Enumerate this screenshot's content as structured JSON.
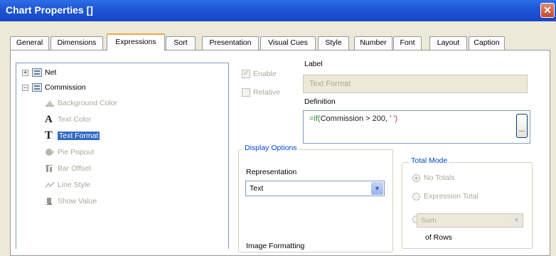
{
  "window": {
    "title": "Chart Properties []",
    "close_glyph": "✕"
  },
  "tabs": [
    {
      "label": "General",
      "active": false
    },
    {
      "label": "Dimensions",
      "active": false
    },
    {
      "label": "Expressions",
      "active": true
    },
    {
      "label": "Sort",
      "active": false
    },
    {
      "label": "Presentation",
      "active": false
    },
    {
      "label": "Visual Cues",
      "active": false
    },
    {
      "label": "Style",
      "active": false
    },
    {
      "label": "Number",
      "active": false
    },
    {
      "label": "Font",
      "active": false
    },
    {
      "label": "Layout",
      "active": false
    },
    {
      "label": "Caption",
      "active": false
    }
  ],
  "tree": {
    "net": {
      "label": "Net",
      "expander": "+"
    },
    "commission": {
      "label": "Commission",
      "expander": "−"
    },
    "attributes": [
      {
        "label": "Background Color",
        "icon": "background-color-icon",
        "enabled": false,
        "selected": false
      },
      {
        "label": "Text Color",
        "icon": "text-color-icon",
        "enabled": false,
        "selected": false
      },
      {
        "label": "Text Format",
        "icon": "text-format-icon",
        "enabled": true,
        "selected": true
      },
      {
        "label": "Pie Popout",
        "icon": "pie-popout-icon",
        "enabled": false,
        "selected": false
      },
      {
        "label": "Bar Offset",
        "icon": "bar-offset-icon",
        "enabled": false,
        "selected": false
      },
      {
        "label": "Line Style",
        "icon": "line-style-icon",
        "enabled": false,
        "selected": false
      },
      {
        "label": "Show Value",
        "icon": "show-value-icon",
        "enabled": false,
        "selected": false
      }
    ]
  },
  "options": {
    "enable": {
      "label": "Enable",
      "checked": true,
      "enabled": false
    },
    "relative": {
      "label": "Relative",
      "checked": false,
      "enabled": false
    }
  },
  "label_section": {
    "title": "Label",
    "value": "Text Format"
  },
  "definition": {
    "title": "Definition",
    "part_prefix": "=if(",
    "part_field": "Commission > 200, '",
    "part_tail": "   ')",
    "button_label": "..."
  },
  "display_options": {
    "title": "Display Options",
    "representation_label": "Representation",
    "representation_value": "Text",
    "image_formatting_label": "Image Formatting"
  },
  "total_mode": {
    "title": "Total Mode",
    "options": [
      {
        "label": "No Totals",
        "selected": true
      },
      {
        "label": "Expression Total",
        "selected": false
      }
    ],
    "sum_value": "Sum",
    "of_rows_label": "of Rows"
  },
  "colors": {
    "title_bar": "#1d55d6",
    "selected": "#316ac5",
    "group_title": "#0046d5",
    "tab_highlight": "#f6a34a"
  }
}
